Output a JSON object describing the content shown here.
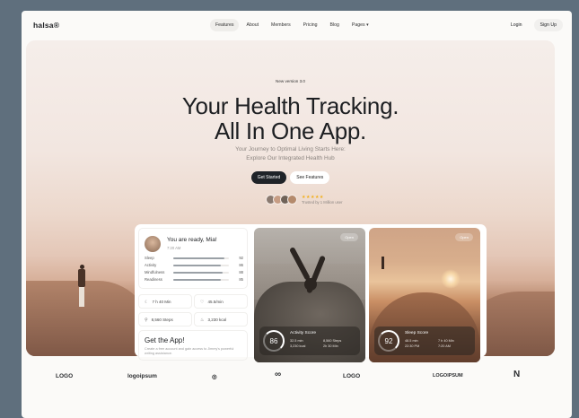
{
  "brand": {
    "logo": "halsa®"
  },
  "nav": {
    "items": [
      "Features",
      "About",
      "Members",
      "Pricing",
      "Blog",
      "Pages ▾"
    ],
    "active": "Features",
    "login": "Login",
    "signup": "Sign Up"
  },
  "hero": {
    "badge": "New version 3.0",
    "title_line1": "Your Health Tracking.",
    "title_line2": "All In One App.",
    "subtitle_line1": "Your Journey to Optimal Living Starts Here:",
    "subtitle_line2": "Explore Our Integrated Health Hub",
    "cta_primary": "Get Started",
    "cta_secondary": "See Features",
    "stars": "★★★★★",
    "trusted": "Trusted by 1 Million user"
  },
  "profile": {
    "greeting": "You are ready, Mia!",
    "time": "7:20 AM",
    "stats": [
      {
        "label": "Sleep",
        "value": "92",
        "pct": 0.92
      },
      {
        "label": "Activity",
        "value": "86",
        "pct": 0.86
      },
      {
        "label": "Mindfulness",
        "value": "88",
        "pct": 0.88
      },
      {
        "label": "Readiness",
        "value": "85",
        "pct": 0.85
      }
    ],
    "tiles": [
      "7 h 40 Min",
      "45.5/min",
      "8,560 Steps",
      "3,230 kcal"
    ]
  },
  "app": {
    "title": "Get the App!",
    "text": "Create a free account and gain access to Jimmy's powerful writing assistance."
  },
  "cards": {
    "activity": {
      "tag": "Open",
      "name": "Activity Score",
      "score": "86",
      "details": [
        "32.5 min",
        "8,560 Steps",
        "3,230 kcal",
        "2h 30 Min"
      ]
    },
    "sleep": {
      "tag": "Open",
      "name": "Sleep Score",
      "score": "92",
      "details": [
        "48.5 min",
        "7 h 40 Min",
        "22:30 PM",
        "7:20 AM"
      ]
    }
  },
  "logos": [
    "LOGO",
    "logoipsum",
    "◎",
    "∞",
    "LOGO",
    "LOGOIPSUM",
    "N"
  ]
}
